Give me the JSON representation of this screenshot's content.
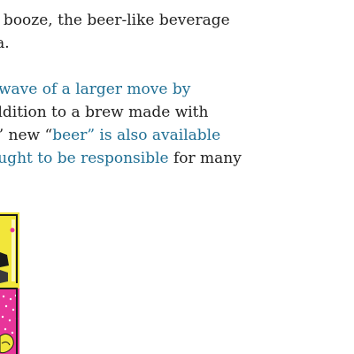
{
  "article": {
    "paragraph1": {
      "line1": "of booze, the beer-like beverage",
      "line2": "ana."
    },
    "paragraph2": {
      "line1_link": "wave of a larger move by",
      "line2_text": "ddition to a brew made with",
      "line3_text": "s’ new “",
      "line3_link": "beer” is also available",
      "line4_link": "ought to be responsible",
      "line4_text": " for many"
    }
  },
  "colors": {
    "body_text": "#1f1f1f",
    "link": "#1f6f94",
    "illustration_yellow": "#f2e63a",
    "illustration_pink": "#e8359a",
    "illustration_outline": "#1a1a1a"
  }
}
